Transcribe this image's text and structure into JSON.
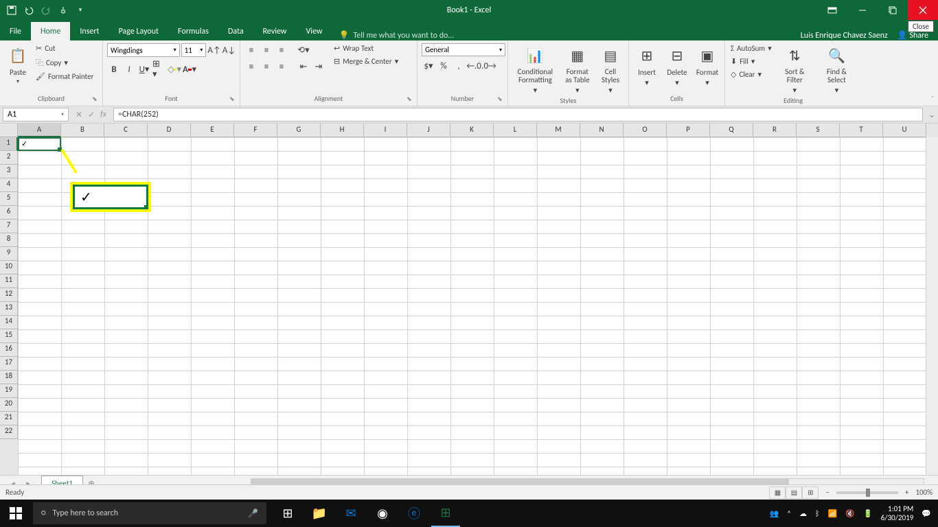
{
  "titlebar": {
    "title": "Book1 - Excel",
    "tooltip": "Close"
  },
  "tabs": {
    "file": "File",
    "home": "Home",
    "insert": "Insert",
    "pagelayout": "Page Layout",
    "formulas": "Formulas",
    "data": "Data",
    "review": "Review",
    "view": "View",
    "tellme": "Tell me what you want to do..."
  },
  "user": {
    "name": "Luis Enrique Chavez Saenz",
    "share": "Share"
  },
  "ribbon": {
    "clipboard": {
      "label": "Clipboard",
      "paste": "Paste",
      "cut": "Cut",
      "copy": "Copy",
      "painter": "Format Painter"
    },
    "font": {
      "label": "Font",
      "name": "Wingdings",
      "size": "11"
    },
    "alignment": {
      "label": "Alignment",
      "wrap": "Wrap Text",
      "merge": "Merge & Center"
    },
    "number": {
      "label": "Number",
      "format": "General"
    },
    "styles": {
      "label": "Styles",
      "cond": "Conditional Formatting",
      "table": "Format as Table",
      "cell": "Cell Styles"
    },
    "cells": {
      "label": "Cells",
      "insert": "Insert",
      "delete": "Delete",
      "format": "Format"
    },
    "editing": {
      "label": "Editing",
      "autosum": "AutoSum",
      "fill": "Fill",
      "clear": "Clear",
      "sort": "Sort & Filter",
      "find": "Find & Select"
    }
  },
  "formula_bar": {
    "cell_ref": "A1",
    "formula": "=CHAR(252)"
  },
  "grid": {
    "columns": [
      "A",
      "B",
      "C",
      "D",
      "E",
      "F",
      "G",
      "H",
      "I",
      "J",
      "K",
      "L",
      "M",
      "N",
      "O",
      "P",
      "Q",
      "R",
      "S",
      "T",
      "U"
    ],
    "rows": [
      "1",
      "2",
      "3",
      "4",
      "5",
      "6",
      "7",
      "8",
      "9",
      "10",
      "11",
      "12",
      "13",
      "14",
      "15",
      "16",
      "17",
      "18",
      "19",
      "20",
      "21",
      "22"
    ],
    "a1_value": "✓",
    "callout_value": "✓"
  },
  "sheet": {
    "name": "Sheet1"
  },
  "status": {
    "ready": "Ready",
    "zoom": "100%"
  },
  "taskbar": {
    "search": "Type here to search",
    "time": "1:01 PM",
    "date": "6/30/2019"
  }
}
